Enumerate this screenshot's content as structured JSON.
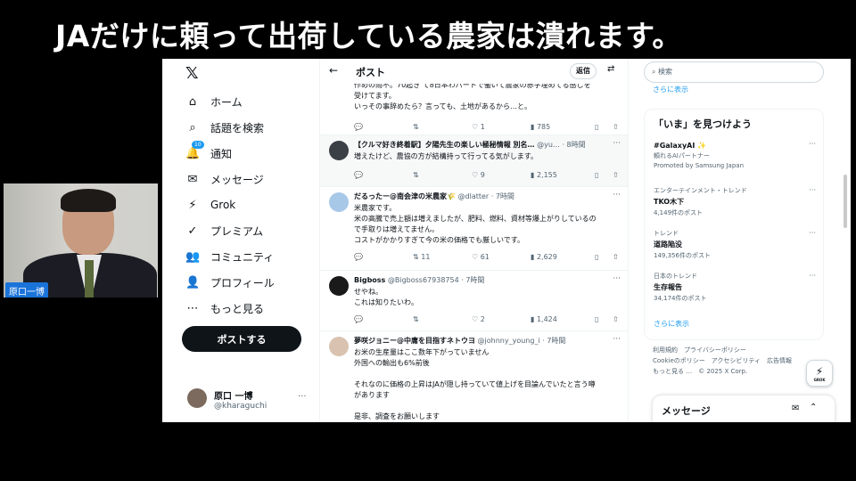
{
  "headline": "JAだけに頼って出荷している農家は潰れます。",
  "camera": {
    "name_label": "原口一博"
  },
  "nav": {
    "logo": "𝕏",
    "items": [
      {
        "icon": "⌂",
        "label": "ホーム"
      },
      {
        "icon": "⌕",
        "label": "話題を検索"
      },
      {
        "icon": "🔔",
        "label": "通知",
        "badge": "10"
      },
      {
        "icon": "✉",
        "label": "メッセージ"
      },
      {
        "icon": "⚡",
        "label": "Grok"
      },
      {
        "icon": "✓",
        "label": "プレミアム"
      },
      {
        "icon": "👥",
        "label": "コミュニティ"
      },
      {
        "icon": "👤",
        "label": "プロフィール"
      },
      {
        "icon": "⋯",
        "label": "もっと見る"
      }
    ],
    "post_button": "ポストする",
    "account": {
      "name": "原口 一博",
      "handle": "@kharaguchi",
      "more": "···"
    }
  },
  "main": {
    "back": "←",
    "title": "ポスト",
    "reply_button": "返信",
    "tweets": [
      {
        "name": "",
        "handle": "",
        "time": "",
        "text": "作めの雨不。70起き て8日本わパートで働いて農家の赤字埋めてる感じを\n受けてます。\nいっその事辞めたら？言っても、土地があるから…と。",
        "replies": "",
        "retweets": "",
        "likes": "1",
        "views": "785"
      },
      {
        "name": "【クルマ好き終着駅】夕陽先生の楽しい極秘情報 別名…",
        "handle": "@yu…",
        "time": "· 8時間",
        "text": "増えたけど、農協の方が結構持って行ってる気がします。",
        "replies": "",
        "retweets": "",
        "likes": "9",
        "views": "2,155"
      },
      {
        "name": "だるったー@南会津の米農家🌾",
        "handle": "@dlatter",
        "time": "· 7時間",
        "text": "米農家です。\n米の高騰で売上額は増えましたが、肥料、燃料、資材等爆上がりしているの\nで手取りは増えてません。\nコストがかかりすぎて今の米の価格でも厳しいです。",
        "replies": "",
        "retweets": "11",
        "likes": "61",
        "views": "2,629"
      },
      {
        "name": "Bigboss",
        "handle": "@Bigboss67938754",
        "time": "· 7時間",
        "text": "せやね。\nこれは知りたいわ。",
        "replies": "",
        "retweets": "",
        "likes": "2",
        "views": "1,424"
      },
      {
        "name": "夢咲ジョニー@中庸を目指すネトウヨ",
        "handle": "@johnny_young_i",
        "time": "· 7時間",
        "text": "お米の生産量はここ数年下がっていません\n外国への輸出も6%前後\n\nそれなのに価格の上昇はJAが隠し持っていて値上げを目論んでいたと言う噂\nがあります\n\n是非、調査をお願いします",
        "replies": "",
        "retweets": "",
        "likes": "",
        "views": ""
      }
    ]
  },
  "sidebar": {
    "search_placeholder": "検索",
    "show_more_top": "さらに表示",
    "trends_title": "「いま」を見つけよう",
    "trends": [
      {
        "category": "",
        "keyword": "#GalaxyAI ✨",
        "sub": "頼れるAIパートナー",
        "sub2": "Promoted by Samsung Japan"
      },
      {
        "category": "エンターテインメント・トレンド",
        "keyword": "TKO木下",
        "sub": "4,149件のポスト",
        "sub2": ""
      },
      {
        "category": "トレンド",
        "keyword": "道路陥没",
        "sub": "149,356件のポスト",
        "sub2": ""
      },
      {
        "category": "日本のトレンド",
        "keyword": "生存報告",
        "sub": "34,174件のポスト",
        "sub2": ""
      }
    ],
    "show_more_bottom": "さらに表示",
    "footer_lines": [
      "利用規約　プライバシーポリシー",
      "Cookieのポリシー　アクセシビリティ　広告情報",
      "もっと見る …　© 2025 X Corp."
    ],
    "grok_label": "GROK",
    "messages_title": "メッセージ"
  }
}
